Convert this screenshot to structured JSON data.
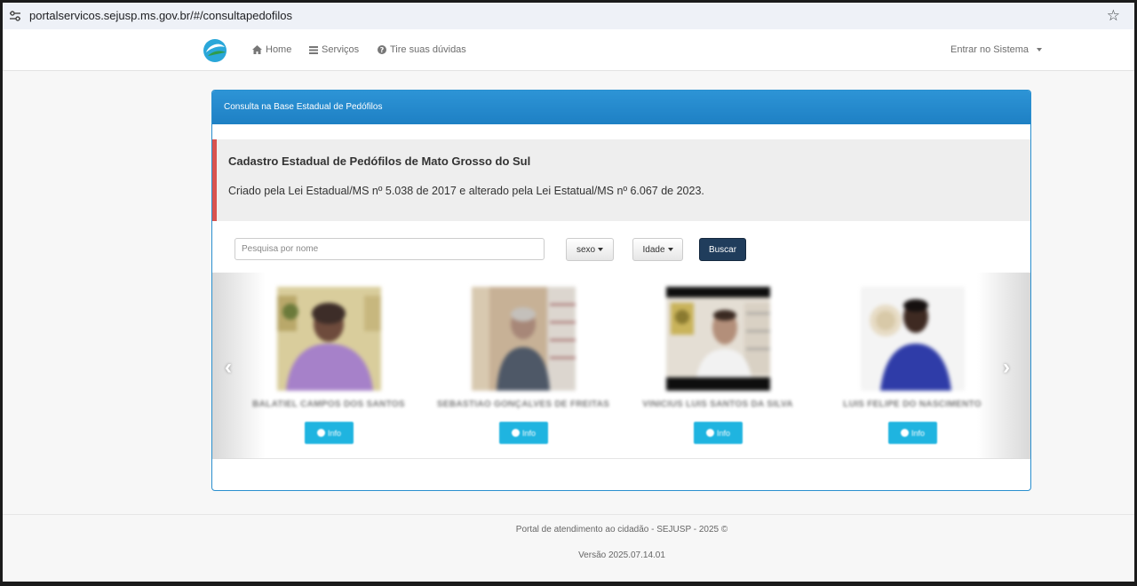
{
  "browser": {
    "url": "portalservicos.sejusp.ms.gov.br/#/consultapedofilos"
  },
  "nav": {
    "home": "Home",
    "services": "Serviços",
    "help": "Tire suas dúvidas",
    "login": "Entrar no Sistema"
  },
  "panel": {
    "heading": "Consulta na Base Estadual de Pedófilos",
    "callout_title": "Cadastro Estadual de Pedófilos de Mato Grosso do Sul",
    "callout_text": "Criado pela Lei Estadual/MS nº 5.038 de 2017 e alterado pela Lei Estatual/MS nº 6.067 de 2023."
  },
  "search": {
    "placeholder": "Pesquisa por nome",
    "sex_label": "sexo",
    "age_label": "Idade",
    "button": "Buscar"
  },
  "cards": [
    {
      "name": "BALATIEL CAMPOS DOS SANTOS",
      "info": "Info"
    },
    {
      "name": "SEBASTIAO GONÇALVES DE FREITAS",
      "info": "Info"
    },
    {
      "name": "VINICIUS LUIS SANTOS DA SILVA",
      "info": "Info"
    },
    {
      "name": "LUIS FELIPE DO NASCIMENTO",
      "info": "Info"
    }
  ],
  "footer": {
    "text": "Portal de atendimento ao cidadão - SEJUSP - 2025 ©",
    "version": "Versão 2025.07.14.01"
  },
  "colors": {
    "panel_header": "#2d94d6",
    "callout_border": "#d9534f",
    "search_button": "#203d5c",
    "info_button": "#1fb4e0"
  }
}
